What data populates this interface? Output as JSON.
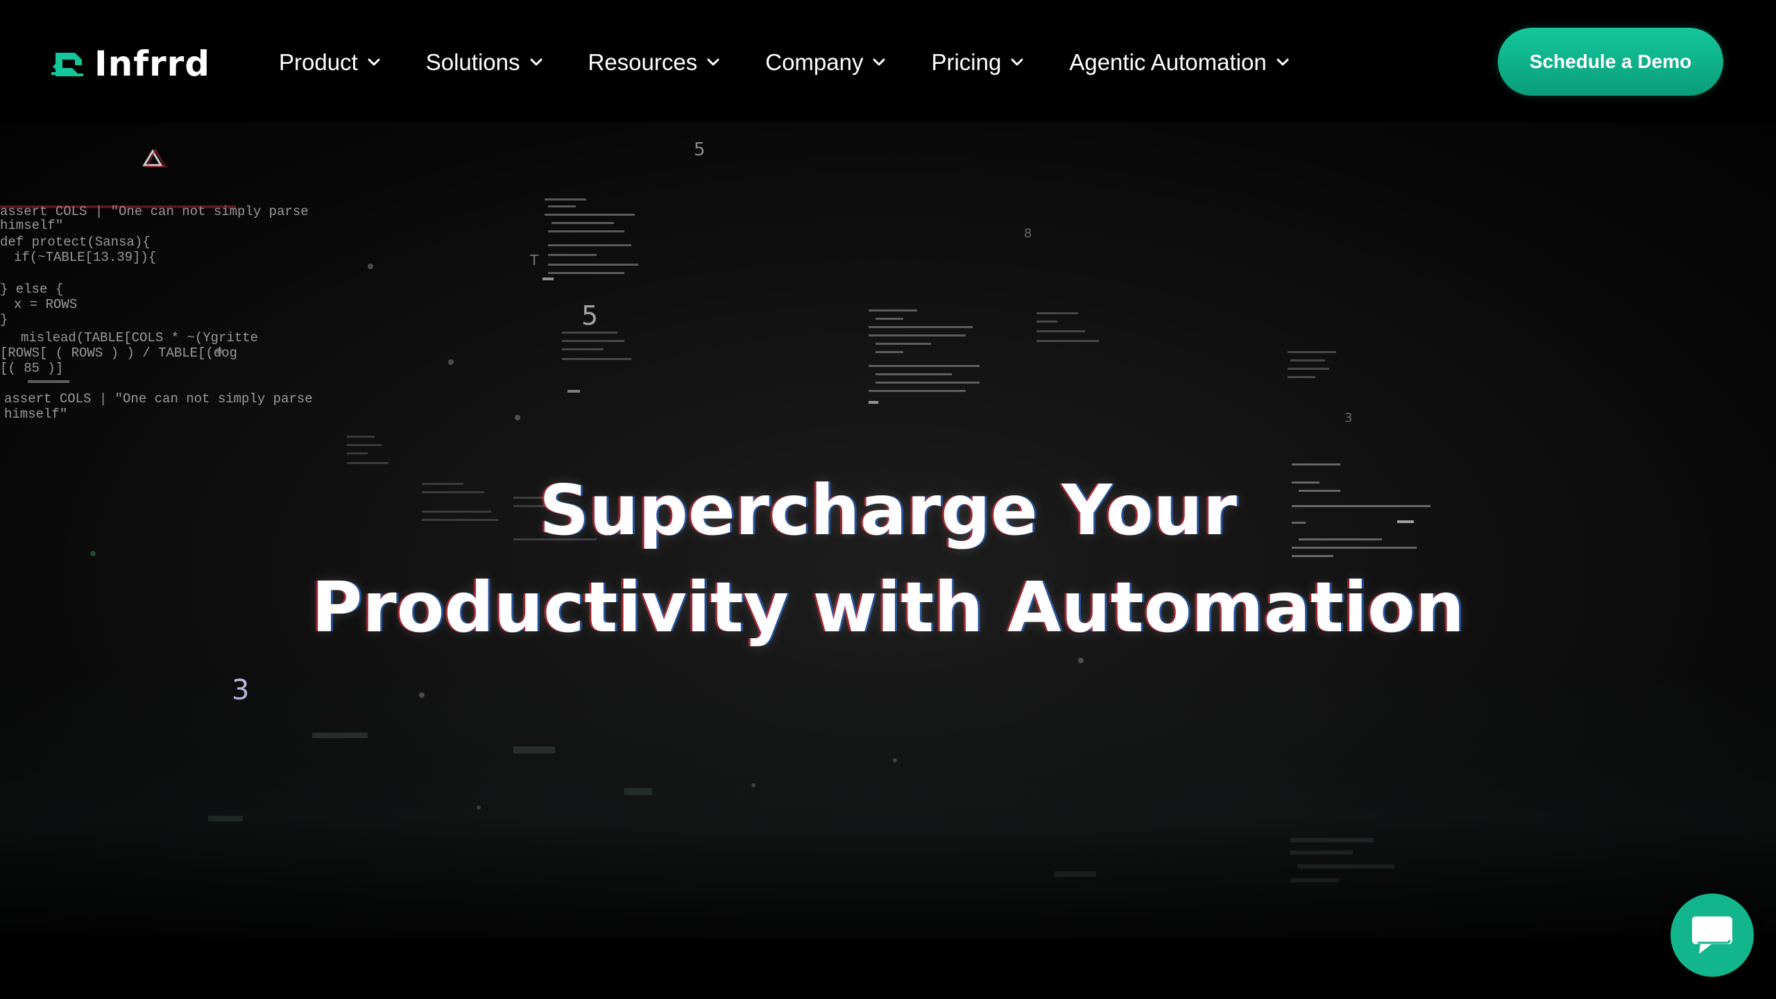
{
  "brand": {
    "name": "Infrrd",
    "logo_icon": "infrrd-logo-icon",
    "accent_color": "#14c79a"
  },
  "nav": {
    "items": [
      {
        "label": "Product",
        "icon": "chevron-down-icon"
      },
      {
        "label": "Solutions",
        "icon": "chevron-down-icon"
      },
      {
        "label": "Resources",
        "icon": "chevron-down-icon"
      },
      {
        "label": "Company",
        "icon": "chevron-down-icon"
      },
      {
        "label": "Pricing",
        "icon": "chevron-down-icon"
      },
      {
        "label": "Agentic Automation",
        "icon": "chevron-down-icon"
      }
    ]
  },
  "cta": {
    "label": "Schedule a Demo"
  },
  "hero": {
    "title_line1": "Supercharge Your",
    "title_line2": "Productivity with Automation",
    "background": {
      "code_snippets": [
        "assert COLS | \"One can not simply parse",
        "himself\"",
        "def protect(Sansa){",
        "  if(~TABLE[13.39]){",
        "} else {",
        "  x = ROWS",
        "}",
        "  mislead(TABLE[COLS * ~(Ygritte",
        "[ROWS[ ( ROWS ) ) / TABLE[(dog",
        "[( 85 )]",
        "assert COLS | \"One can not simply parse",
        "himself\""
      ],
      "floating_digits": [
        "5",
        "5",
        "3",
        "8",
        "3",
        "T"
      ]
    }
  },
  "chat": {
    "icon": "chat-bubble-icon",
    "color": "#13b58c"
  }
}
